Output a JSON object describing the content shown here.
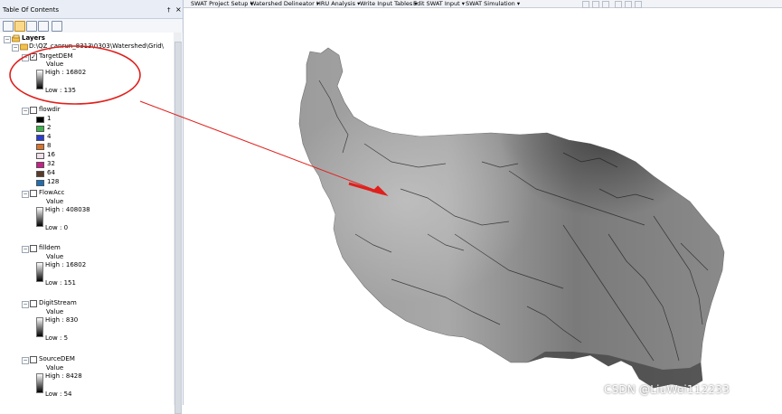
{
  "toc": {
    "title": "Table Of Contents",
    "pin": "†",
    "close": "×",
    "root_label": "Layers",
    "group_label": "D:\\QZ_canrun_8313\\0303\\Watershed\\Grid\\",
    "value_label": "Value",
    "layers": [
      {
        "name": "TargetDEM",
        "checked": true,
        "high": "High : 16802",
        "low": "Low : 135"
      },
      {
        "name": "flowdir",
        "checked": false,
        "classes": [
          {
            "label": "1",
            "color": "#000000"
          },
          {
            "label": "2",
            "color": "#3cb44b"
          },
          {
            "label": "4",
            "color": "#2b3ccf"
          },
          {
            "label": "8",
            "color": "#d9742a"
          },
          {
            "label": "16",
            "color": "#f2dfe8"
          },
          {
            "label": "32",
            "color": "#c81e8a"
          },
          {
            "label": "64",
            "color": "#5a3a2a"
          },
          {
            "label": "128",
            "color": "#1f6eb4"
          }
        ]
      },
      {
        "name": "FlowAcc",
        "checked": false,
        "high": "High : 408038",
        "low": "Low : 0"
      },
      {
        "name": "filldem",
        "checked": false,
        "high": "High : 16802",
        "low": "Low : 151"
      },
      {
        "name": "DigitStream",
        "checked": false,
        "high": "High : 830",
        "low": "Low : 5"
      },
      {
        "name": "SourceDEM",
        "checked": false,
        "high": "High : 8428",
        "low": "Low : 54"
      }
    ]
  },
  "toolbar_menus": [
    "SWAT Project Setup ▾",
    "Watershed Delineator ▾",
    "HRU Analysis ▾",
    "Write Input Tables ▾",
    "Edit SWAT Input ▾",
    "SWAT Simulation ▾"
  ],
  "watermark": "CSDN @LiuWei112233",
  "annotation_color": "#e0201c",
  "icons": [
    "pin-icon",
    "close-icon",
    "list-by-drawing-order-icon",
    "list-by-source-icon",
    "list-by-visibility-icon",
    "list-by-selection-icon",
    "options-icon"
  ]
}
